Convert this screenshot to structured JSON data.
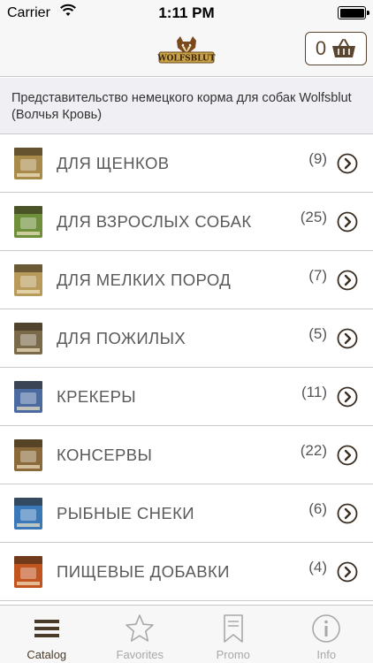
{
  "status_bar": {
    "carrier": "Carrier",
    "time": "1:11 PM",
    "icons": [
      "wifi-icon",
      "battery-icon"
    ]
  },
  "header": {
    "logo_name": "wolfsblut-logo",
    "logo_text": "WOLFSBLUT",
    "cart_count": "0",
    "brand_color": "#5a4630"
  },
  "intro_text": "Представительство немецкого корма для собак Wolfsblut (Волчья Кровь)",
  "categories": [
    {
      "label": "ДЛЯ ЩЕНКОВ",
      "count": "(9)",
      "thumb_color": "#a88a4a"
    },
    {
      "label": "ДЛЯ ВЗРОСЛЫХ СОБАК",
      "count": "(25)",
      "thumb_color": "#6f8f3a"
    },
    {
      "label": "ДЛЯ МЕЛКИХ ПОРОД",
      "count": "(7)",
      "thumb_color": "#b89a5a"
    },
    {
      "label": "ДЛЯ ПОЖИЛЫХ",
      "count": "(5)",
      "thumb_color": "#7a6a4a"
    },
    {
      "label": "КРЕКЕРЫ",
      "count": "(11)",
      "thumb_color": "#4a6aa0"
    },
    {
      "label": "КОНСЕРВЫ",
      "count": "(22)",
      "thumb_color": "#8a6a3a"
    },
    {
      "label": "РЫБНЫЕ СНЕКИ",
      "count": "(6)",
      "thumb_color": "#3a78b8"
    },
    {
      "label": "ПИЩЕВЫЕ ДОБАВКИ",
      "count": "(4)",
      "thumb_color": "#c2551f"
    }
  ],
  "tabs": [
    {
      "label": "Catalog",
      "icon": "list-icon",
      "active": true
    },
    {
      "label": "Favorites",
      "icon": "star-icon",
      "active": false
    },
    {
      "label": "Promo",
      "icon": "bookmark-icon",
      "active": false
    },
    {
      "label": "Info",
      "icon": "info-icon",
      "active": false
    }
  ]
}
